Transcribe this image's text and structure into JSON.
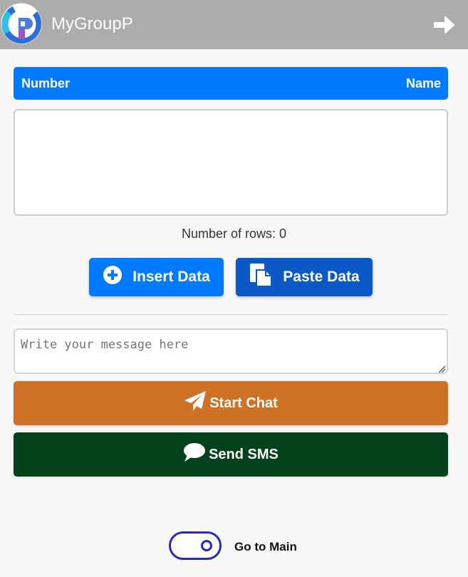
{
  "header": {
    "app_title": "MyGroupP",
    "logo_icon": "mygroupp-logo-icon",
    "exit_icon": "arrow-right-icon"
  },
  "table": {
    "columns": [
      "Number",
      "Name"
    ],
    "rows": [],
    "row_count_text": "Number of rows: 0"
  },
  "actions": {
    "insert_label": "Insert Data",
    "insert_icon": "plus-circle-icon",
    "paste_label": "Paste Data",
    "paste_icon": "paste-icon"
  },
  "message": {
    "value": "",
    "placeholder": "Write your message here"
  },
  "send": {
    "chat_label": "Start Chat",
    "chat_icon": "paper-plane-icon",
    "sms_label": "Send SMS",
    "sms_icon": "speech-bubble-icon"
  },
  "toggle": {
    "label": "Go to Main",
    "state": "on"
  },
  "colors": {
    "header_bg": "#acacac",
    "primary_blue": "#007bff",
    "paste_blue": "#0a59c4",
    "chat_orange": "#cd7226",
    "sms_green": "#04421b",
    "toggle_blue": "#2727c3"
  }
}
